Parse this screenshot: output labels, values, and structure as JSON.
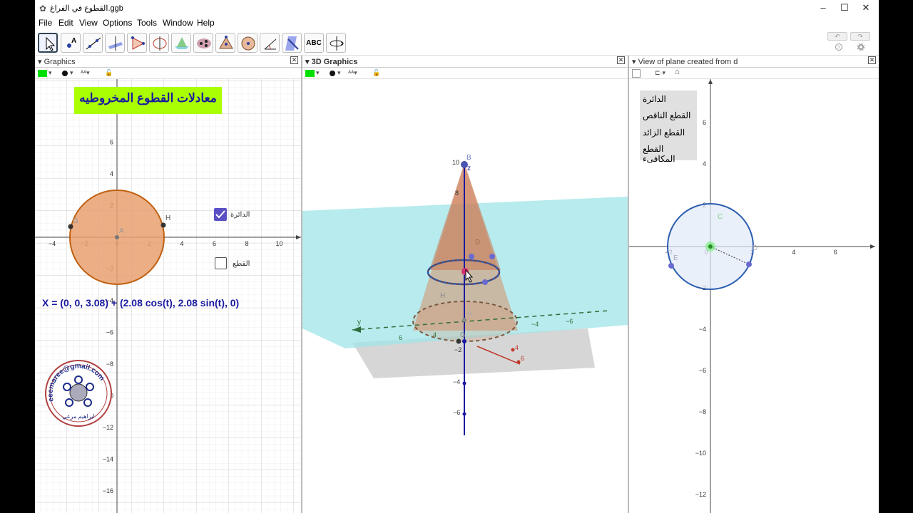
{
  "window": {
    "title": "القطوع في الفراغ.ggb",
    "minimize": "–",
    "maximize": "☐",
    "close": "✕"
  },
  "menu": {
    "items": [
      "File",
      "Edit",
      "View",
      "Options",
      "Tools",
      "Window",
      "Help"
    ]
  },
  "toolbar": {
    "text_tool_label": "ABC",
    "undo": "↶",
    "redo": "↷"
  },
  "panels": {
    "graphics": {
      "title": "Graphics"
    },
    "graphics3d": {
      "title": "3D Graphics"
    },
    "plane_view": {
      "title": "View of plane created from d"
    }
  },
  "graphics": {
    "heading": "معادلات القطوع المخروطيه",
    "equation": "X = (0, 0, 3.08) + (2.08 cos(t), 2.08 sin(t), 0)",
    "checkbox_circle": {
      "label": "الدائرة",
      "checked": true
    },
    "checkbox_cone": {
      "label": "القطع",
      "checked": false
    },
    "x_ticks": [
      "−4",
      "−2",
      "0",
      "2",
      "4",
      "6",
      "8",
      "10"
    ],
    "y_ticks": [
      "6",
      "4",
      "2",
      "−2",
      "−4",
      "−6",
      "−8",
      "−10",
      "−12",
      "−14",
      "−16"
    ],
    "point_labels": {
      "a": "A",
      "h": "H",
      "g": "G"
    },
    "logo_text_top": "eeemaree@gmail.com",
    "logo_text_bottom": "ابراهيم مرعي"
  },
  "graphics3d": {
    "z_ticks": [
      "10",
      "8",
      "−2",
      "−4",
      "−6"
    ],
    "axis_y_label": "y",
    "axis_z_label": "z",
    "point_labels": {
      "b": "B",
      "d": "D",
      "h": "H",
      "g": "G",
      "a": "A"
    },
    "y_ticks": [
      "6",
      "4"
    ],
    "x_ticks": [
      "−4",
      "−6"
    ],
    "red_ticks": [
      "4",
      "6"
    ]
  },
  "plane_view": {
    "menu_items": [
      "الدائرة",
      "القطع الناقص",
      "القطع الزائد",
      "القطع المكافىء"
    ],
    "x_ticks": [
      "−2",
      "0",
      "2",
      "4",
      "6"
    ],
    "y_ticks": [
      "6",
      "4",
      "2",
      "−2",
      "−4",
      "−6",
      "−8",
      "−10",
      "−12"
    ],
    "point_labels": {
      "c": "C",
      "e": "E",
      "d": "D"
    }
  },
  "colors": {
    "accent_green": "#00e000",
    "circle_fill": "#e8a070",
    "circle_stroke": "#c06010",
    "plane_fill": "#9fe4e8",
    "cone_fill": "#d7906a",
    "blue_circle": "#2b5db0",
    "equation_color": "#1a1aa0",
    "heading_bg": "#aaff00"
  }
}
